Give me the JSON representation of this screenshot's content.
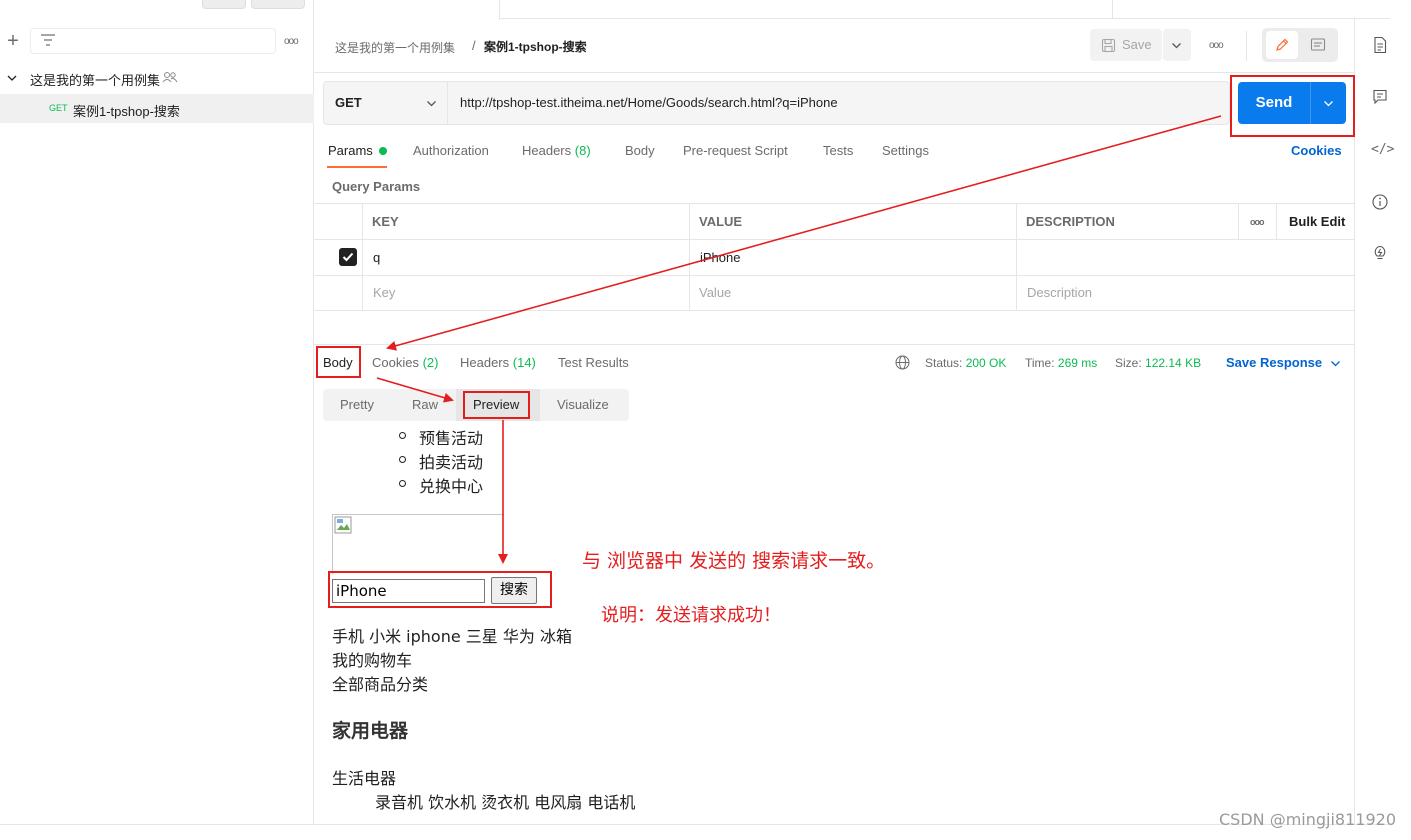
{
  "sidebar": {
    "collection_name": "这是我的第一个用例集",
    "request_method": "GET",
    "request_name": "案例1-tpshop-搜索"
  },
  "header": {
    "breadcrumb_collection": "这是我的第一个用例集",
    "breadcrumb_separator": "/",
    "breadcrumb_request": "案例1-tpshop-搜索",
    "save_label": "Save"
  },
  "request": {
    "method": "GET",
    "url": "http://tpshop-test.itheima.net/Home/Goods/search.html?q=iPhone",
    "send_label": "Send"
  },
  "request_tabs": {
    "params": "Params",
    "authorization": "Authorization",
    "headers": "Headers",
    "headers_count": "(8)",
    "body": "Body",
    "prerequest": "Pre-request Script",
    "tests": "Tests",
    "settings": "Settings",
    "cookies_link": "Cookies"
  },
  "params_table": {
    "section_title": "Query Params",
    "headers": {
      "key": "KEY",
      "value": "VALUE",
      "description": "DESCRIPTION",
      "bulk_edit": "Bulk Edit"
    },
    "rows": [
      {
        "key": "q",
        "value": "iPhone",
        "description": "",
        "enabled": true
      }
    ],
    "placeholders": {
      "key": "Key",
      "value": "Value",
      "description": "Description"
    }
  },
  "response": {
    "tabs": {
      "body": "Body",
      "cookies": "Cookies",
      "cookies_count": "(2)",
      "headers": "Headers",
      "headers_count": "(14)",
      "test_results": "Test Results"
    },
    "status_label": "Status:",
    "status_value": "200 OK",
    "time_label": "Time:",
    "time_value": "269 ms",
    "size_label": "Size:",
    "size_value": "122.14 KB",
    "save_response": "Save Response",
    "view_modes": [
      "Pretty",
      "Raw",
      "Preview",
      "Visualize"
    ],
    "active_view": "Preview"
  },
  "preview": {
    "list_items": [
      "预售活动",
      "拍卖活动",
      "兑换中心"
    ],
    "search_value": "iPhone",
    "search_button": "搜索",
    "hot_keywords": "手机 小米 iphone 三星 华为 冰箱",
    "cart_link": "我的购物车",
    "all_categories": "全部商品分类",
    "category_heading": "家用电器",
    "subcategory": "生活电器",
    "subcategory_items": "录音机 饮水机 烫衣机 电风扇 电话机"
  },
  "annotations": {
    "consistent_note": "与 浏览器中 发送的 搜索请求一致。",
    "success_note": "说明：发送请求成功！",
    "color": "#e41e1e"
  },
  "watermark": "CSDN @mingji811920",
  "colors": {
    "accent_orange": "#ff6c37",
    "send_blue": "#097bed",
    "link_blue": "#0265d2",
    "success_green": "#0cbb52"
  },
  "icons": [
    "plus-icon",
    "filter-icon",
    "more-icon",
    "chevron-down-icon",
    "people-icon",
    "save-icon",
    "pencil-icon",
    "comment-icon",
    "document-icon",
    "code-icon",
    "info-icon",
    "bulb-icon",
    "globe-icon",
    "checkbox-icon",
    "broken-image-icon"
  ]
}
